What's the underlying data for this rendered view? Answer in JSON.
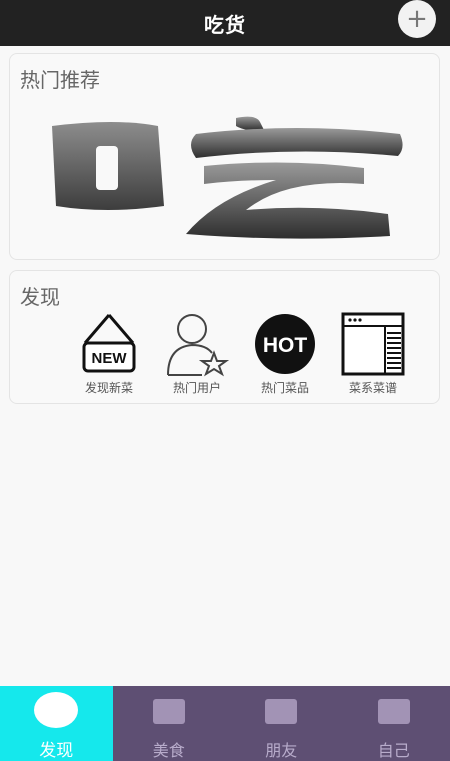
{
  "header": {
    "title": "吃货",
    "add_icon": "plus-icon",
    "add_symbol": "+"
  },
  "hot": {
    "title": "热门推荐",
    "banner_text": "吃"
  },
  "discover": {
    "title": "发现",
    "items": [
      {
        "label": "发现新菜",
        "icon": "new-sign-icon",
        "badge": "NEW"
      },
      {
        "label": "热门用户",
        "icon": "user-star-icon"
      },
      {
        "label": "热门菜品",
        "icon": "hot-badge-icon",
        "badge": "HOT"
      },
      {
        "label": "菜系菜谱",
        "icon": "menu-list-icon"
      }
    ]
  },
  "tabbar": {
    "active_color": "#15e8ec",
    "bar_color": "#5e4f73",
    "tabs": [
      {
        "label": "发现",
        "active": true
      },
      {
        "label": "美食",
        "active": false
      },
      {
        "label": "朋友",
        "active": false
      },
      {
        "label": "自己",
        "active": false
      }
    ]
  }
}
